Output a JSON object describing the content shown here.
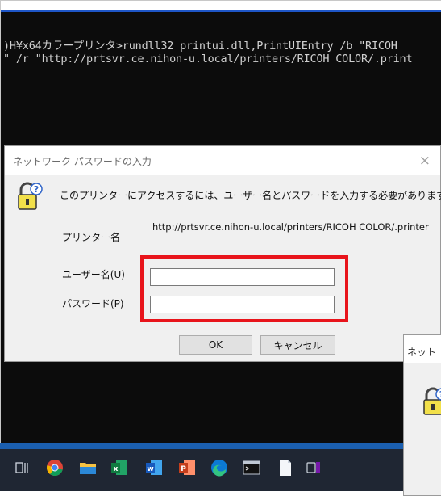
{
  "console": {
    "line1": ")H¥x64カラープリンタ>rundll32 printui.dll,PrintUIEntry /b \"RICOH",
    "line2": "\" /r \"http://prtsvr.ce.nihon-u.local/printers/RICOH COLOR/.print"
  },
  "dialog": {
    "title": "ネットワーク パスワードの入力",
    "close_glyph": "×",
    "message": "このプリンターにアクセスするには、ユーザー名とパスワードを入力する必要があります。",
    "printer_name_label": "プリンター名",
    "printer_name_value": "http://prtsvr.ce.nihon-u.local/printers/RICOH COLOR/.printer",
    "username_label": "ユーザー名(U)",
    "username_value": "",
    "password_label": "パスワード(P)",
    "password_value": "",
    "ok_label": "OK",
    "cancel_label": "キャンセル",
    "icon": "lock-key-icon"
  },
  "dialog2": {
    "title": "ネット",
    "icon": "lock-key-icon"
  },
  "taskbar": {
    "icons": [
      "task-view-icon",
      "chrome-icon",
      "file-explorer-icon",
      "excel-icon",
      "word-icon",
      "powerpoint-icon",
      "edge-icon",
      "terminal-icon",
      "document-icon",
      "onenote-icon"
    ],
    "excel_text": "x",
    "word_text": "w",
    "powerpoint_text": "P"
  },
  "colors": {
    "highlight": "#e8141b",
    "taskbar_bg": "#1f2633",
    "console_bg": "#0c0c0c",
    "dialog_bg": "#f0f0f0"
  }
}
